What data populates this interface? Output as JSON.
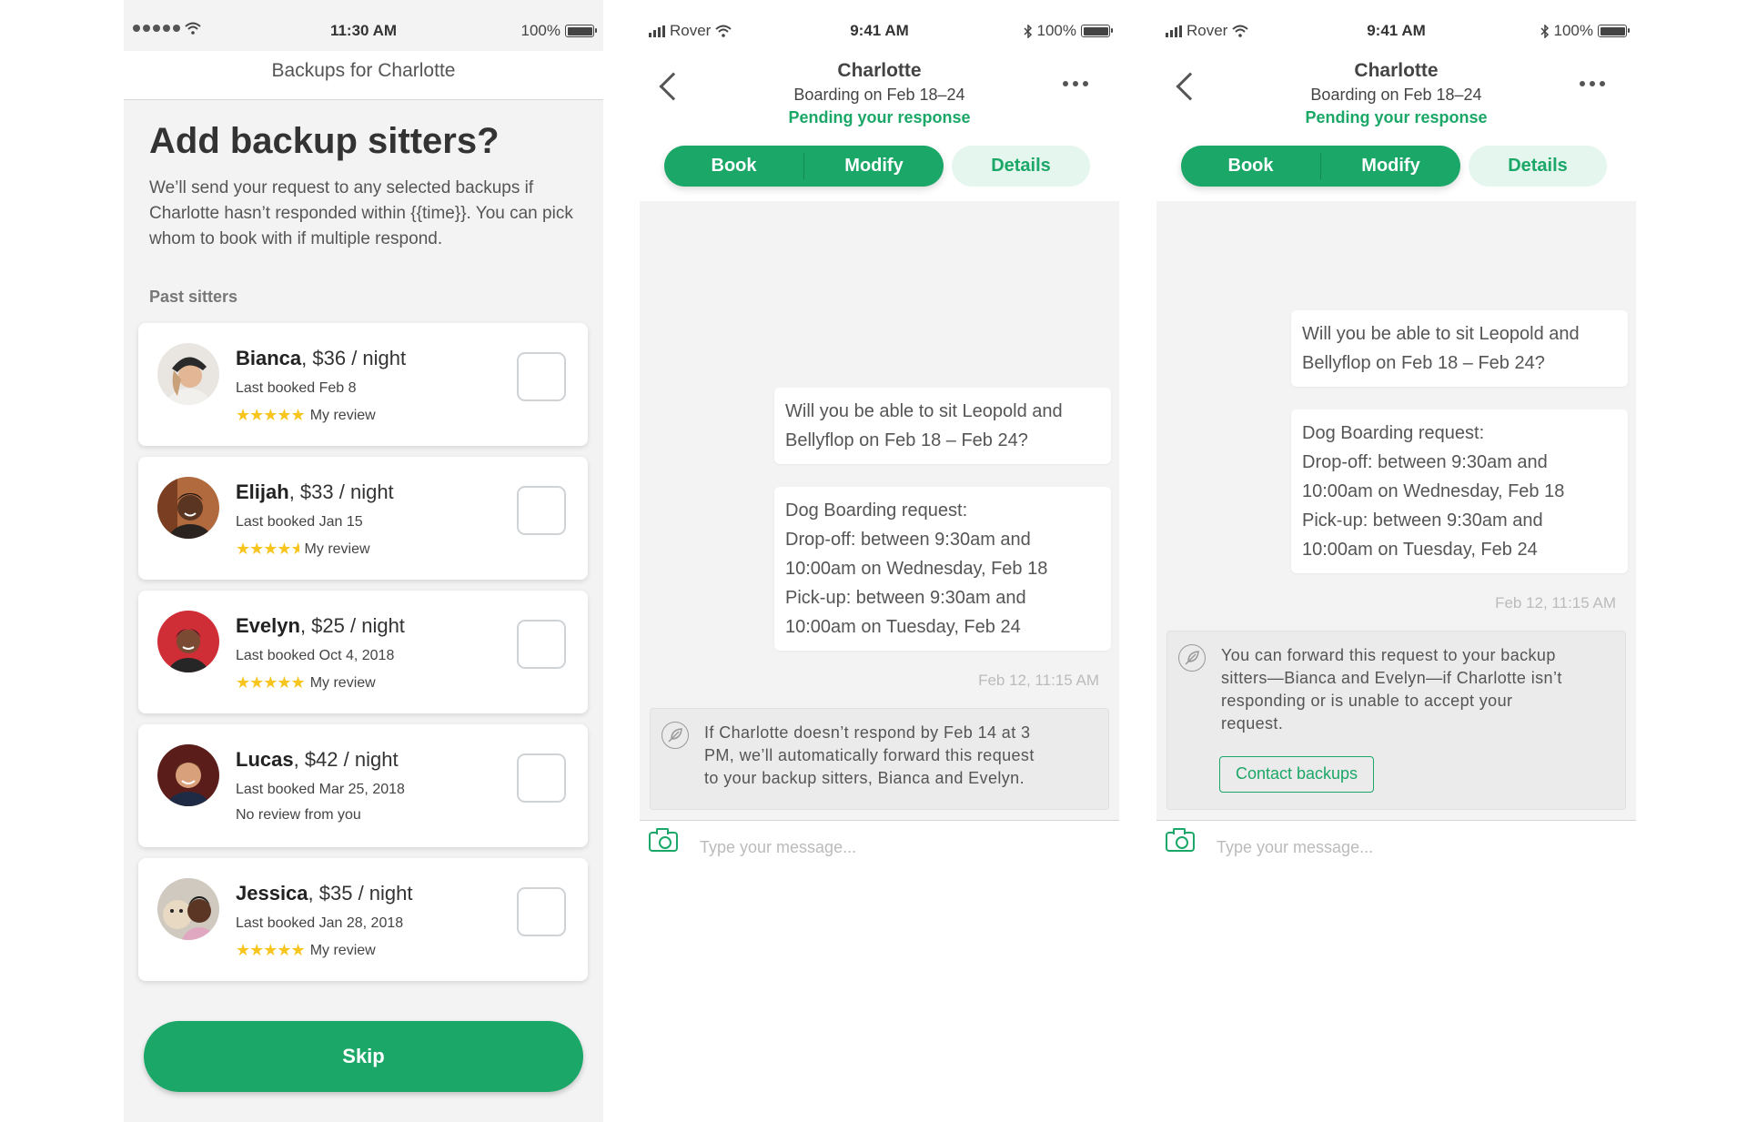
{
  "screen1": {
    "status": {
      "time": "11:30 AM",
      "battery": "100%"
    },
    "header": "Backups for Charlotte",
    "title": "Add backup sitters?",
    "description": "We’ll send your request to any selected backups if Charlotte hasn’t responded within {{time}}. You can pick whom to book with if multiple respond.",
    "section_label": "Past sitters",
    "sitters": [
      {
        "name": "Bianca",
        "rate": ", $36 / night",
        "last_booked": "Last booked Feb 8",
        "review": "My review",
        "rating": 5
      },
      {
        "name": "Elijah",
        "rate": ", $33 / night",
        "last_booked": "Last booked Jan 15",
        "review": "My review",
        "rating": 4.5
      },
      {
        "name": "Evelyn",
        "rate": ", $25 / night",
        "last_booked": "Last booked Oct 4, 2018",
        "review": "My review",
        "rating": 5
      },
      {
        "name": "Lucas",
        "rate": ", $42 / night",
        "last_booked": "Last booked Mar 25, 2018",
        "review": "No review from you",
        "rating": 0
      },
      {
        "name": "Jessica",
        "rate": ", $35 / night",
        "last_booked": "Last booked Jan 28, 2018",
        "review": "My review",
        "rating": 5
      }
    ],
    "skip_label": "Skip"
  },
  "screen2": {
    "status": {
      "carrier": "Rover",
      "time": "9:41 AM",
      "battery": "100%"
    },
    "contact_name": "Charlotte",
    "subtitle": "Boarding on Feb 18–24",
    "pending": "Pending your response",
    "tabs": {
      "book": "Book",
      "modify": "Modify",
      "details": "Details"
    },
    "message1": [
      "Will you be able to sit Leopold and",
      "Bellyflop on Feb 18 – Feb 24?"
    ],
    "message2": [
      "Dog Boarding request:",
      "Drop-off: between 9:30am and",
      "10:00am on Wednesday, Feb 18",
      "Pick-up: between 9:30am and",
      "10:00am on Tuesday, Feb 24"
    ],
    "timestamp": "Feb 12, 11:15 AM",
    "notice": [
      "If Charlotte doesn’t respond by Feb 14 at 3",
      "PM, we’ll automatically forward this request",
      "to your backup sitters, Bianca and Evelyn."
    ],
    "composer_placeholder": "Type your message..."
  },
  "screen3": {
    "status": {
      "carrier": "Rover",
      "time": "9:41 AM",
      "battery": "100%"
    },
    "contact_name": "Charlotte",
    "subtitle": "Boarding on Feb 18–24",
    "pending": "Pending your response",
    "tabs": {
      "book": "Book",
      "modify": "Modify",
      "details": "Details"
    },
    "message1": [
      "Will you be able to sit Leopold and",
      "Bellyflop on Feb 18 – Feb 24?"
    ],
    "message2": [
      "Dog Boarding request:",
      "Drop-off: between 9:30am and",
      "10:00am on Wednesday, Feb 18",
      "Pick-up: between 9:30am and",
      "10:00am on Tuesday, Feb 24"
    ],
    "timestamp": "Feb 12, 11:15 AM",
    "notice": [
      "You can forward this request to your backup",
      "sitters—Bianca and Evelyn—if Charlotte isn’t",
      "responding or is unable to accept your",
      "request."
    ],
    "contact_backups_label": "Contact backups",
    "composer_placeholder": "Type your message..."
  },
  "colors": {
    "brand_green": "#1ba767",
    "star_yellow": "#f7c51e",
    "details_bg": "#e5f6ee"
  }
}
